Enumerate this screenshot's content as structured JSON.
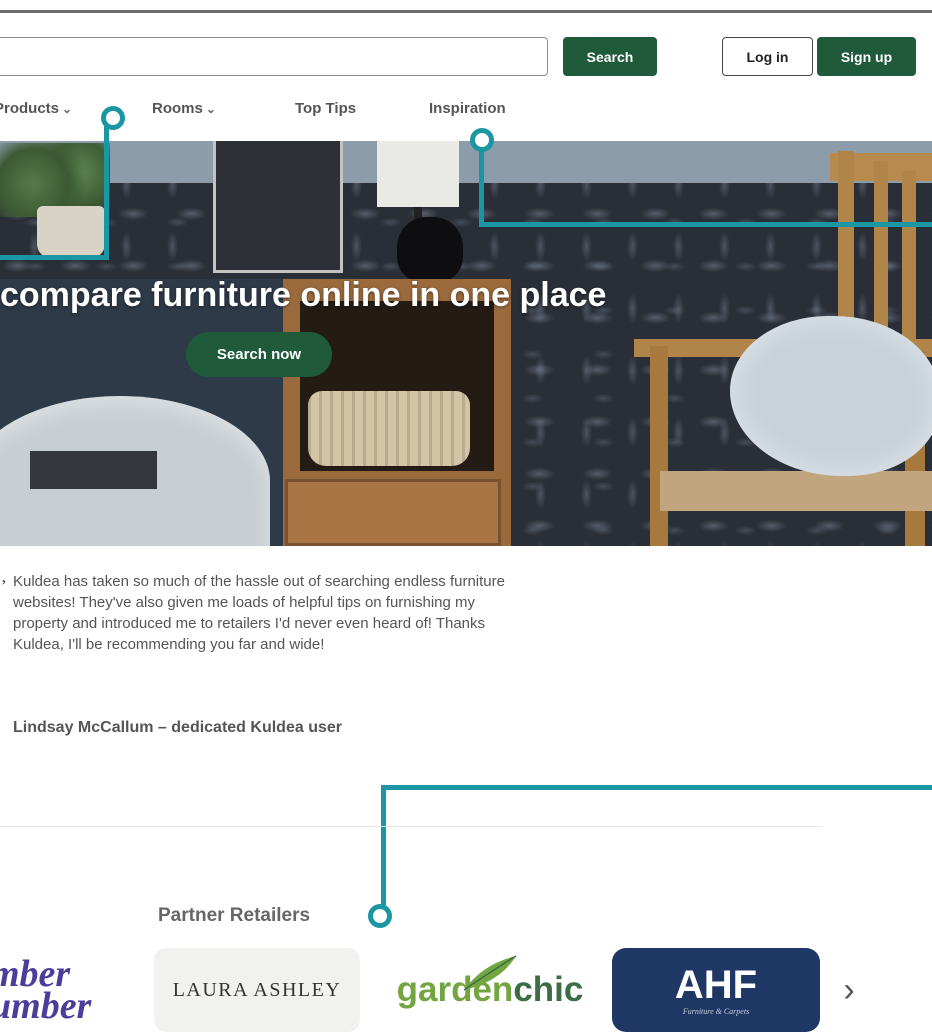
{
  "header": {
    "search": {
      "value": "",
      "placeholder": "",
      "button_label": "Search"
    },
    "login_label": "Log in",
    "signup_label": "Sign up"
  },
  "nav": {
    "items": [
      {
        "label": "Products",
        "has_dropdown": true
      },
      {
        "label": "Rooms",
        "has_dropdown": true
      },
      {
        "label": "Top Tips",
        "has_dropdown": false
      },
      {
        "label": "Inspiration",
        "has_dropdown": false
      }
    ],
    "dropdown_glyph": "⌄"
  },
  "hero": {
    "headline": "compare furniture online in one place",
    "cta_label": "Search now"
  },
  "testimonial": {
    "quote_mark": ",",
    "text": "Kuldea has taken so much of the hassle out of searching endless furniture websites! They've also given me loads of helpful tips on furnishing my property and introduced me to retailers I'd never even heard of! Thanks Kuldea, I'll be recommending you far and wide!",
    "author": "Lindsay McCallum – dedicated Kuldea user"
  },
  "partners": {
    "title": "Partner Retailers",
    "logos": [
      {
        "line1": "mber",
        "line2": "umber"
      },
      {
        "text": "LAURA ASHLEY"
      },
      {
        "part1": "garden",
        "part2": "chic"
      },
      {
        "text": "AHF",
        "tagline": "Furniture & Carpets"
      }
    ],
    "next_glyph": "›"
  },
  "colors": {
    "brand_green": "#1f5a3a",
    "callout_teal": "#1b97a3",
    "ahf_navy": "#1e3764",
    "lumber_purple": "#4b3e9a"
  },
  "icons": {
    "dropdown": "chevron-down-icon",
    "next": "chevron-right-icon"
  }
}
